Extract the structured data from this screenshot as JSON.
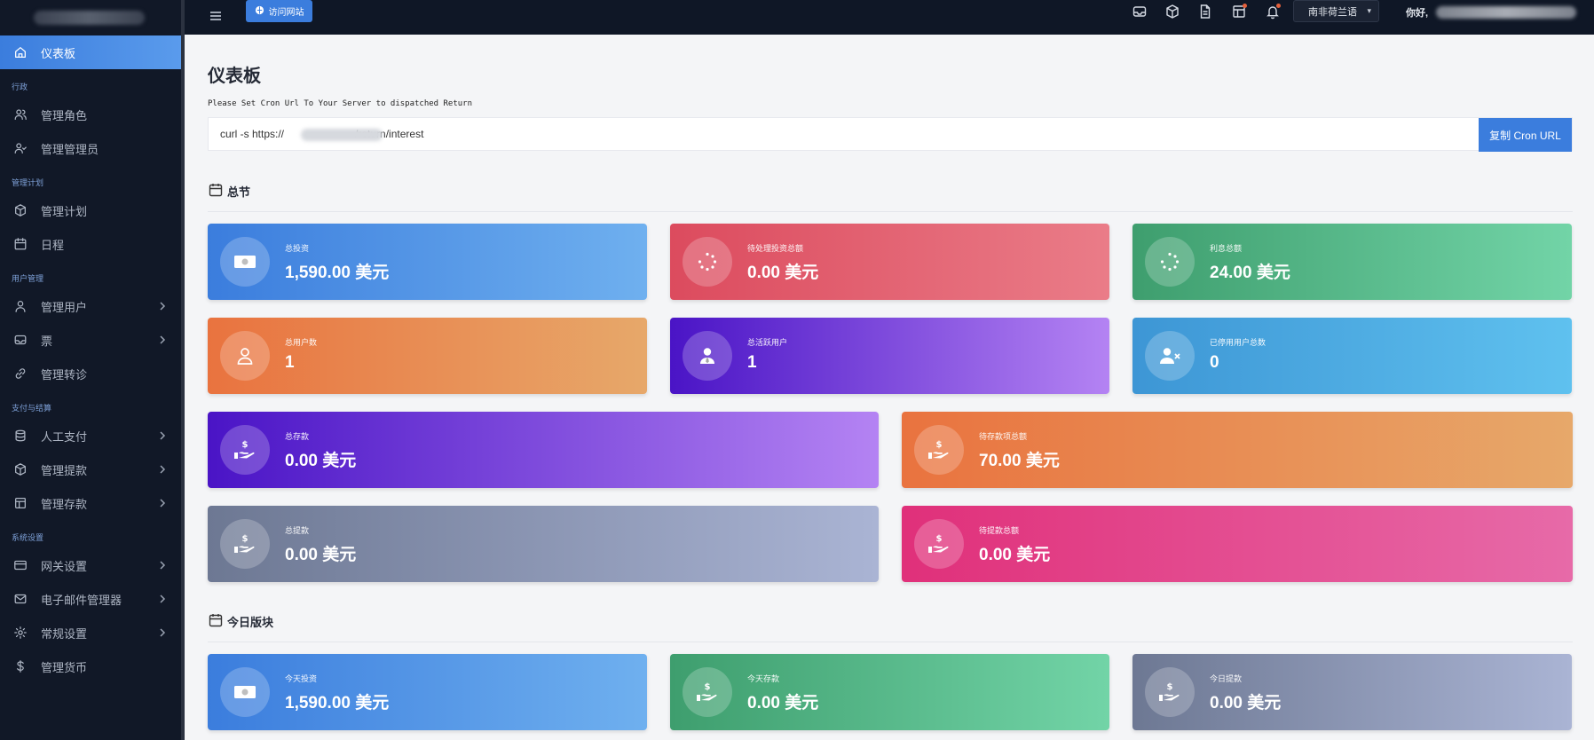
{
  "header": {
    "visit_site_label": "访问网站",
    "language": "南非荷兰语",
    "greeting": "你好,"
  },
  "sidebar": {
    "items": [
      {
        "type": "item",
        "label": "仪表板",
        "icon": "home-icon",
        "active": true
      },
      {
        "type": "section",
        "label": "行政"
      },
      {
        "type": "item",
        "label": "管理角色",
        "icon": "users-icon"
      },
      {
        "type": "item",
        "label": "管理管理员",
        "icon": "user-check-icon"
      },
      {
        "type": "section",
        "label": "管理计划"
      },
      {
        "type": "item",
        "label": "管理计划",
        "icon": "box-icon"
      },
      {
        "type": "item",
        "label": "日程",
        "icon": "calendar-icon"
      },
      {
        "type": "section",
        "label": "用户管理"
      },
      {
        "type": "item",
        "label": "管理用户",
        "icon": "user-icon",
        "chevron": true
      },
      {
        "type": "item",
        "label": "票",
        "icon": "inbox-icon",
        "chevron": true
      },
      {
        "type": "item",
        "label": "管理转诊",
        "icon": "link-icon"
      },
      {
        "type": "section",
        "label": "支付与结算"
      },
      {
        "type": "item",
        "label": "人工支付",
        "icon": "database-icon",
        "chevron": true
      },
      {
        "type": "item",
        "label": "管理提款",
        "icon": "box-icon",
        "chevron": true
      },
      {
        "type": "item",
        "label": "管理存款",
        "icon": "layout-icon",
        "chevron": true
      },
      {
        "type": "section",
        "label": "系统设置"
      },
      {
        "type": "item",
        "label": "网关设置",
        "icon": "credit-card-icon",
        "chevron": true
      },
      {
        "type": "item",
        "label": "电子邮件管理器",
        "icon": "mail-icon",
        "chevron": true
      },
      {
        "type": "item",
        "label": "常规设置",
        "icon": "settings-icon",
        "chevron": true
      },
      {
        "type": "item",
        "label": "管理货币",
        "icon": "dollar-icon"
      }
    ]
  },
  "page": {
    "title": "仪表板",
    "cron_note": "Please Set Cron Url To Your Server to dispatched Return",
    "cron_url": "curl -s https://                        /return/interest",
    "copy_label": "复制 Cron URL",
    "section_total": "总节",
    "section_today": "今日版块"
  },
  "cards_total": [
    {
      "label": "总投资",
      "value": "1,590.00 美元",
      "icon": "cash-icon"
    },
    {
      "label": "待处理投资总额",
      "value": "0.00 美元",
      "icon": "spinner-icon"
    },
    {
      "label": "利息总额",
      "value": "24.00 美元",
      "icon": "spinner-icon"
    },
    {
      "label": "总用户数",
      "value": "1",
      "icon": "user-icon"
    },
    {
      "label": "总活跃用户",
      "value": "1",
      "icon": "user-tie-icon"
    },
    {
      "label": "已停用用户总数",
      "value": "0",
      "icon": "user-x-icon"
    },
    {
      "label": "总存款",
      "value": "0.00 美元",
      "icon": "hand-dollar-icon"
    },
    {
      "label": "待存款项总额",
      "value": "70.00 美元",
      "icon": "hand-dollar-icon"
    },
    {
      "label": "总提款",
      "value": "0.00 美元",
      "icon": "hand-dollar-icon"
    },
    {
      "label": "待提款总额",
      "value": "0.00 美元",
      "icon": "hand-dollar-icon"
    }
  ],
  "cards_today": [
    {
      "label": "今天投资",
      "value": "1,590.00 美元",
      "icon": "cash-icon"
    },
    {
      "label": "今天存款",
      "value": "0.00 美元",
      "icon": "hand-dollar-icon"
    },
    {
      "label": "今日提款",
      "value": "0.00 美元",
      "icon": "hand-dollar-icon"
    }
  ]
}
